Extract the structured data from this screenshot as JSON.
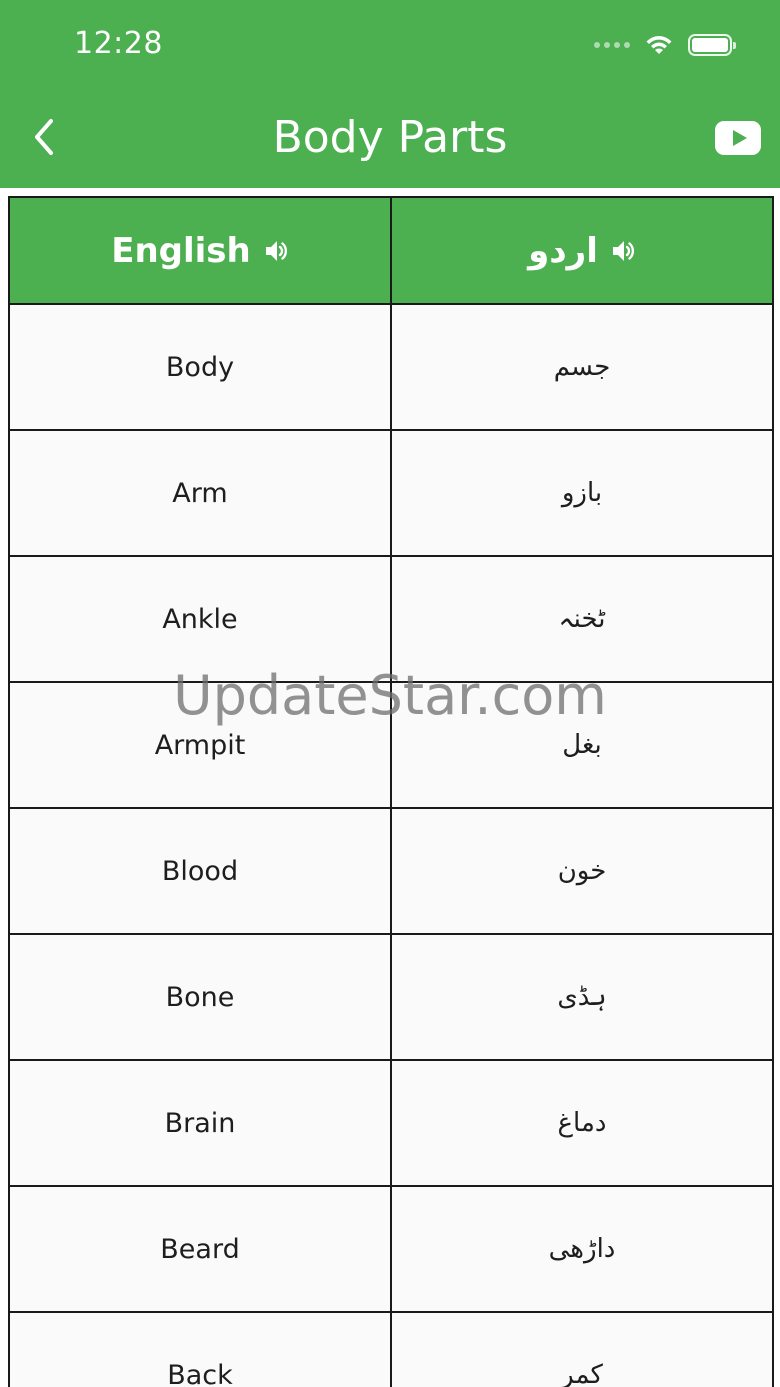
{
  "status_bar": {
    "time": "12:28"
  },
  "nav": {
    "title": "Body Parts",
    "back_icon": "chevron-left-icon",
    "video_icon": "youtube-play-icon"
  },
  "table": {
    "headers": [
      {
        "label": "English",
        "icon": "speaker-icon"
      },
      {
        "label": "اردو",
        "icon": "speaker-icon"
      }
    ],
    "rows": [
      {
        "english": "Body",
        "urdu": "جسم"
      },
      {
        "english": "Arm",
        "urdu": "بازو"
      },
      {
        "english": "Ankle",
        "urdu": "ٹخنہ"
      },
      {
        "english": "Armpit",
        "urdu": "بغل"
      },
      {
        "english": "Blood",
        "urdu": "خون"
      },
      {
        "english": "Bone",
        "urdu": "ہڈی"
      },
      {
        "english": "Brain",
        "urdu": "دماغ"
      },
      {
        "english": "Beard",
        "urdu": "داڑھی"
      },
      {
        "english": "Back",
        "urdu": "کمر"
      }
    ]
  },
  "watermark": "UpdateStar.com",
  "colors": {
    "primary": "#4caf50",
    "cell_background": "#fafafa",
    "border": "#1a1a1a"
  }
}
